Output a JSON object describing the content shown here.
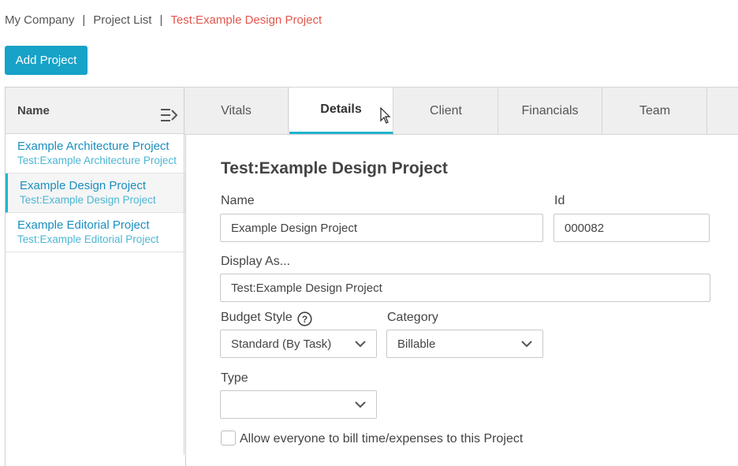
{
  "breadcrumb": {
    "company": "My Company",
    "sep1": "|",
    "project_list": "Project List",
    "sep2": "|",
    "current": "Test:Example Design Project"
  },
  "toolbar": {
    "add_project_label": "Add Project"
  },
  "sidebar": {
    "header": "Name",
    "items": [
      {
        "name": "Example Architecture Project",
        "sub": "Test:Example Architecture Project"
      },
      {
        "name": "Example Design Project",
        "sub": "Test:Example Design Project"
      },
      {
        "name": "Example Editorial Project",
        "sub": "Test:Example Editorial Project"
      }
    ]
  },
  "tabs": [
    {
      "label": "Vitals"
    },
    {
      "label": "Details"
    },
    {
      "label": "Client"
    },
    {
      "label": "Financials"
    },
    {
      "label": "Team"
    }
  ],
  "details": {
    "title": "Test:Example Design Project",
    "name_label": "Name",
    "name_value": "Example Design Project",
    "id_label": "Id",
    "id_value": "000082",
    "display_label": "Display As...",
    "display_value": "Test:Example Design Project",
    "budget_label": "Budget Style",
    "budget_value": "Standard (By Task)",
    "category_label": "Category",
    "category_value": "Billable",
    "type_label": "Type",
    "type_value": "",
    "allow_label": "Allow everyone to bill time/expenses to this Project"
  },
  "colors": {
    "accent": "#17a2c8",
    "breadcrumb_current": "#e2574c",
    "link": "#1a8fc0"
  }
}
